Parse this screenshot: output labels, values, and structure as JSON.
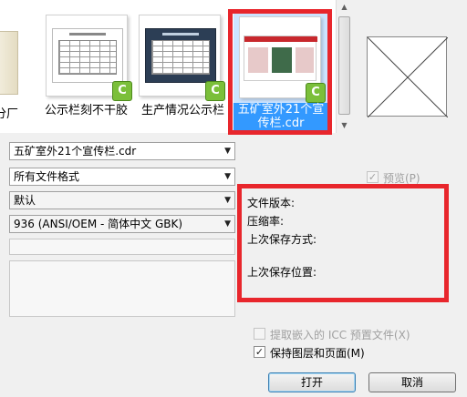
{
  "files": [
    {
      "label": "公示栏刻不干胶"
    },
    {
      "label": "生产情况公示栏"
    },
    {
      "label": "五矿室外21个宣传栏.cdr",
      "selected": true
    }
  ],
  "left_partial_label": "分厂",
  "controls": {
    "filename": "五矿室外21个宣传栏.cdr",
    "filetype": "所有文件格式",
    "option": "默认",
    "encoding": "936  (ANSI/OEM - 简体中文 GBK)"
  },
  "preview_checkbox": {
    "label": "预览(P)",
    "checked": true
  },
  "info": {
    "file_version": "文件版本:",
    "compression": "压缩率:",
    "last_save_method": "上次保存方式:",
    "last_save_location": "上次保存位置:"
  },
  "extract_icc": {
    "label": "提取嵌入的 ICC 预置文件(X)",
    "checked": false
  },
  "keep_layers": {
    "label": "保持图层和页面(M)",
    "checked": true
  },
  "buttons": {
    "open": "打开",
    "cancel": "取消"
  },
  "highlight_color": "#e8262c",
  "selection_color": "#3399ff",
  "cdr_icon_color": "#7bbf3a"
}
